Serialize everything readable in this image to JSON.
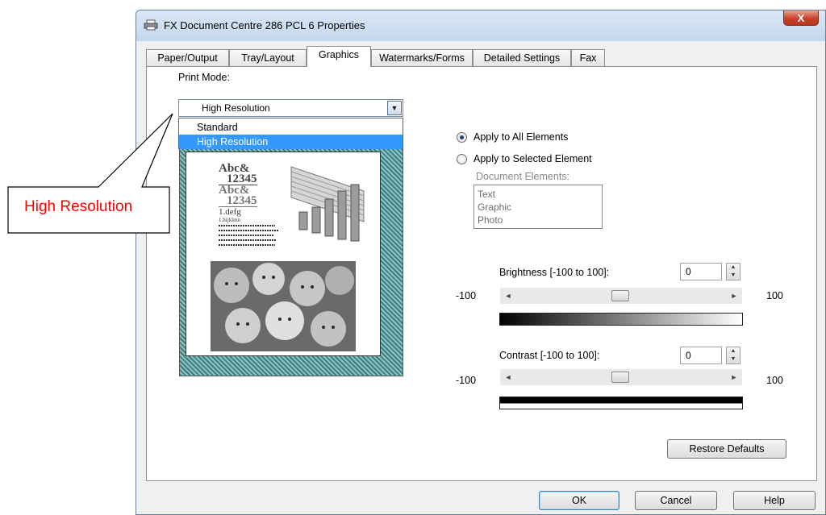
{
  "window": {
    "title": "FX Document Centre 286 PCL 6 Properties",
    "close_label": "X"
  },
  "tabs": [
    {
      "label": "Paper/Output",
      "active": false
    },
    {
      "label": "Tray/Layout",
      "active": false
    },
    {
      "label": "Graphics",
      "active": true
    },
    {
      "label": "Watermarks/Forms",
      "active": false
    },
    {
      "label": "Detailed Settings",
      "active": false
    },
    {
      "label": "Fax",
      "active": false
    }
  ],
  "graphics": {
    "print_mode_label": "Print Mode:",
    "print_mode_value": "High Resolution",
    "print_mode_options": [
      "Standard",
      "High Resolution"
    ],
    "print_mode_highlighted": "High Resolution",
    "apply_all_label": "Apply to All Elements",
    "apply_selected_label": "Apply to Selected Element",
    "apply_all_selected": true,
    "document_elements_label": "Document Elements:",
    "document_elements": [
      "Text",
      "Graphic",
      "Photo"
    ],
    "brightness": {
      "label": "Brightness [-100 to 100]:",
      "value": "0",
      "min_label": "-100",
      "max_label": "100"
    },
    "contrast": {
      "label": "Contrast [-100 to 100]:",
      "value": "0",
      "min_label": "-100",
      "max_label": "100"
    },
    "restore_defaults_label": "Restore Defaults",
    "preview_sample": {
      "line1": "Abc&",
      "line2": "12345",
      "line3": "Abc&",
      "line4": "12345",
      "line5": "1.defg",
      "line6": "1.hijklmn"
    }
  },
  "footer": {
    "ok_label": "OK",
    "cancel_label": "Cancel",
    "help_label": "Help"
  },
  "callout": {
    "text": "High Resolution",
    "color": "#ff0000"
  },
  "colors": {
    "selection": "#3399ff",
    "window_frame": "#c9dcee"
  }
}
